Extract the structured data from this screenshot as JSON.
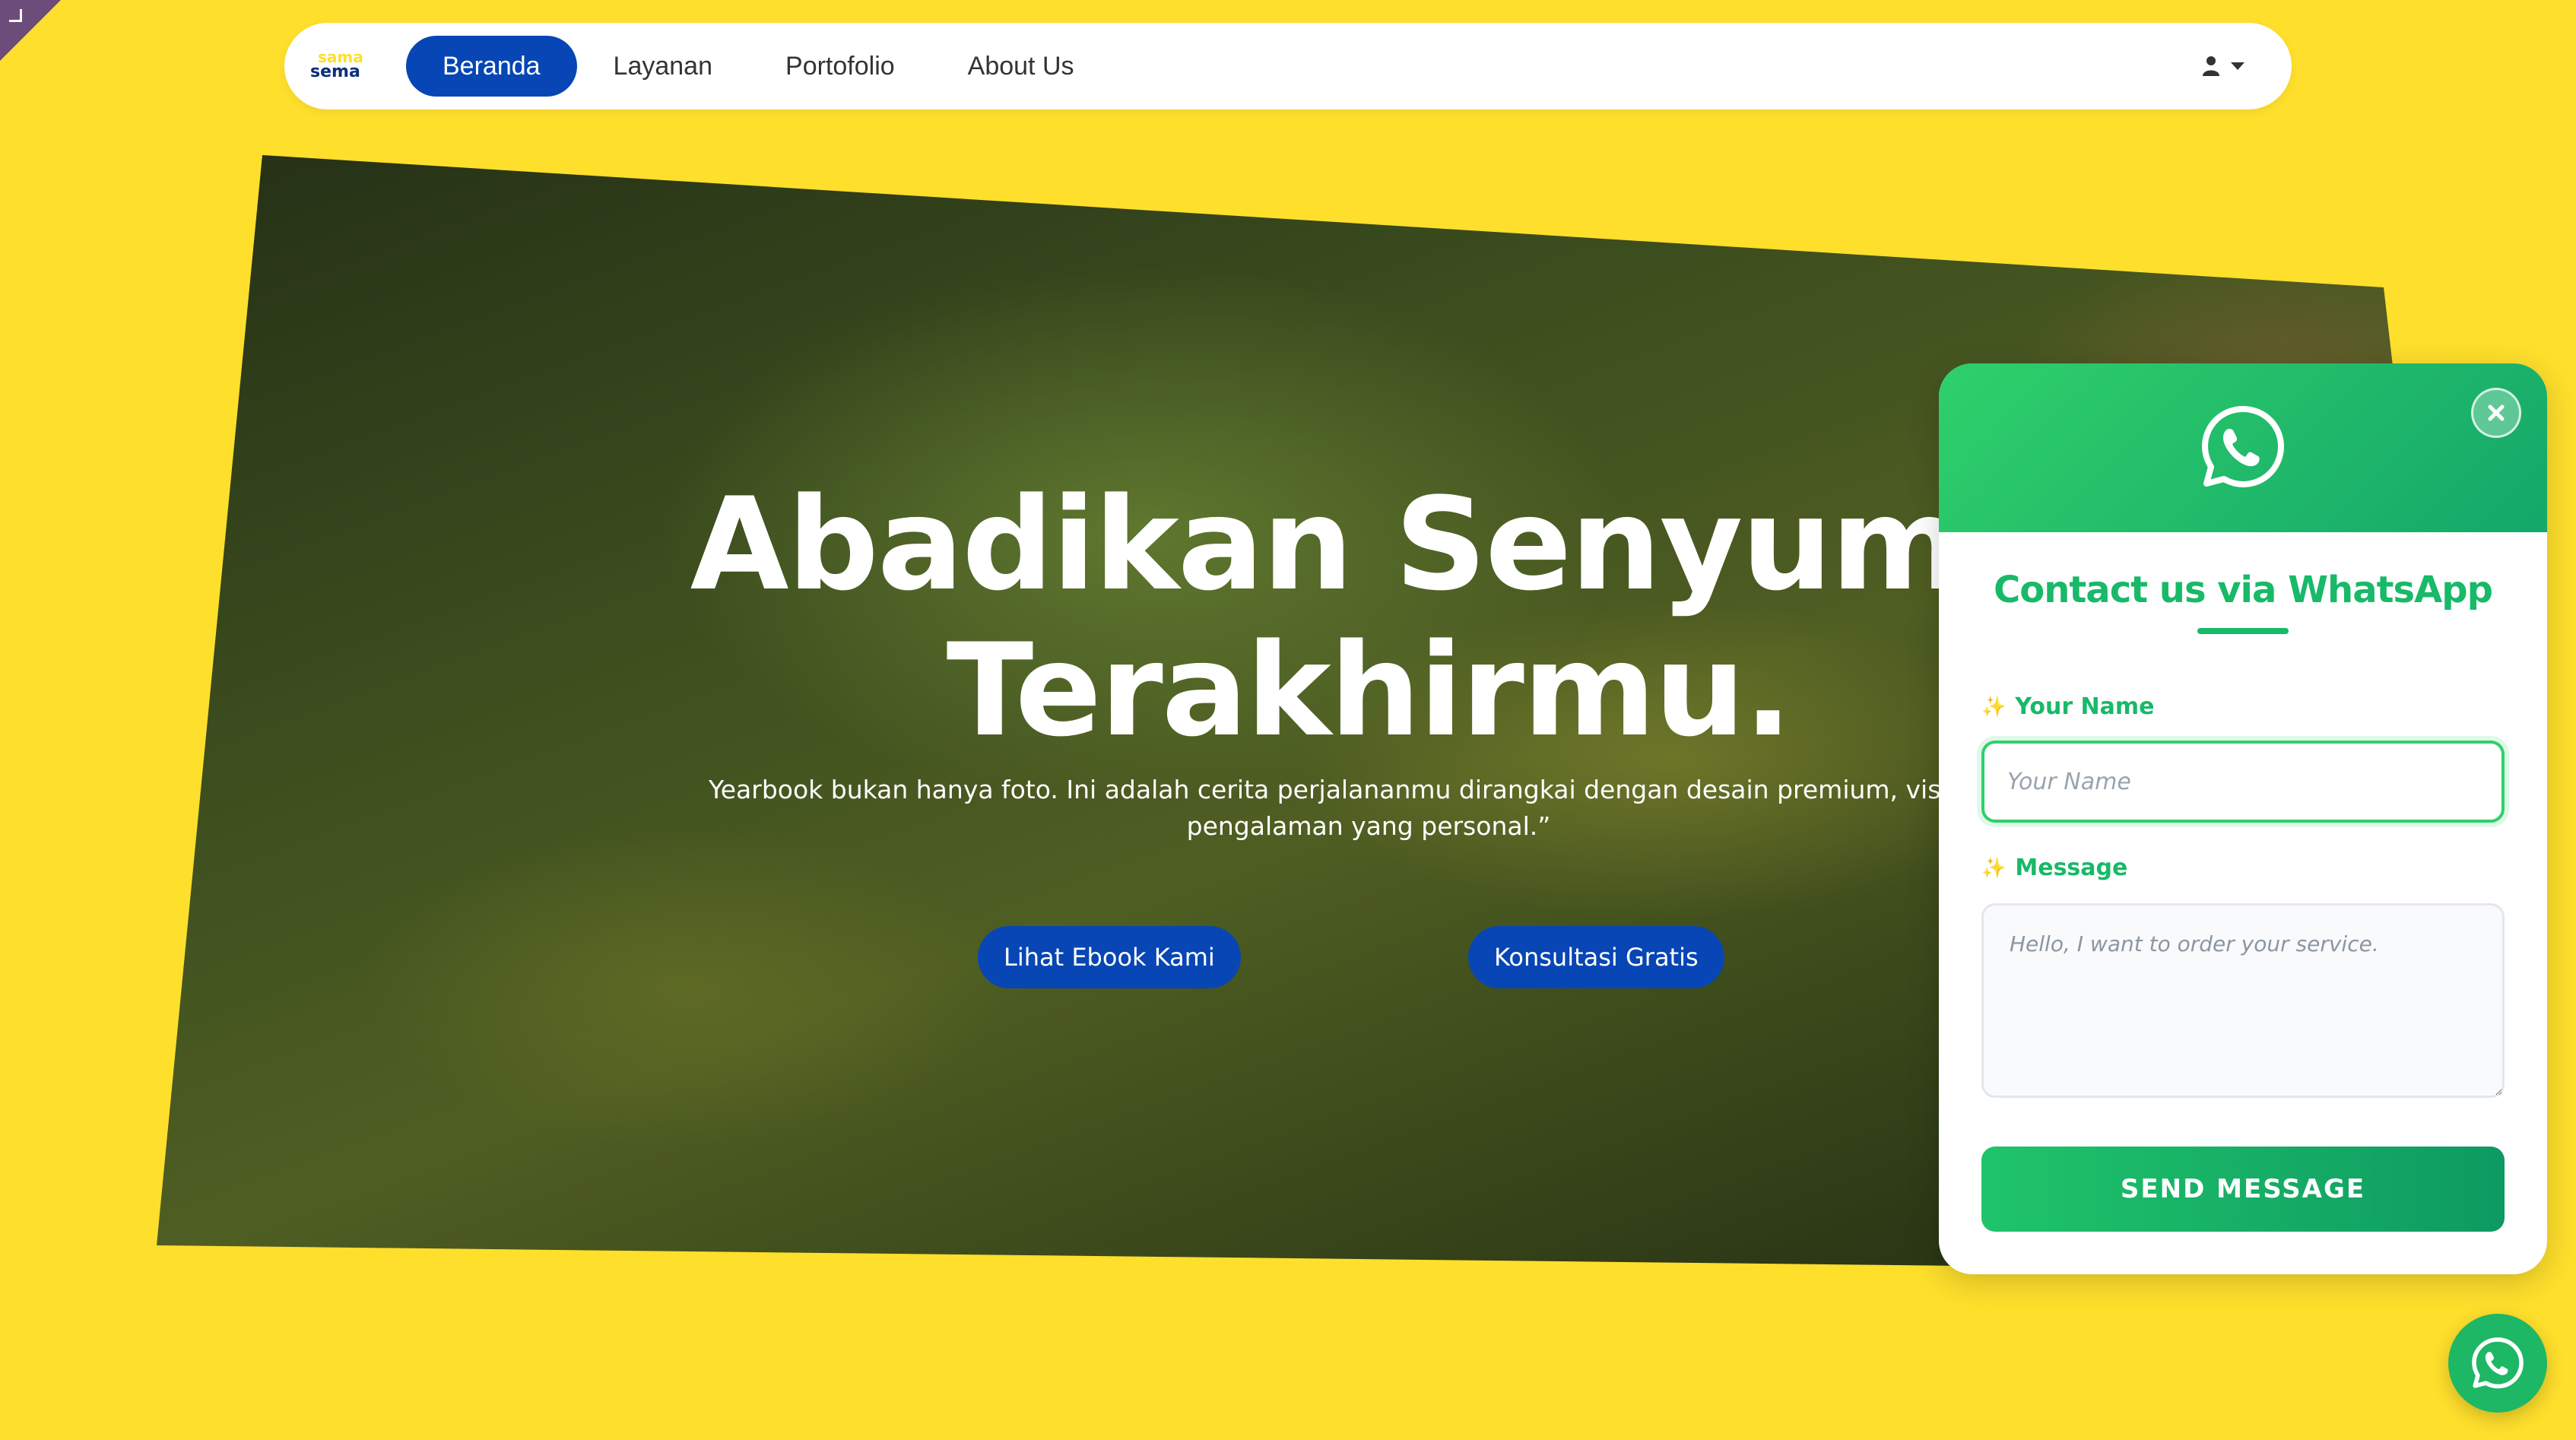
{
  "colors": {
    "page_background": "#FEDF2C",
    "nav_active": "#0746B4",
    "whatsapp_green": "#18B968",
    "hero_button": "#0746B4"
  },
  "navbar": {
    "logo": {
      "line1": "sama",
      "line2": "sema"
    },
    "items": [
      {
        "label": "Beranda",
        "active": true
      },
      {
        "label": "Layanan",
        "active": false
      },
      {
        "label": "Portofolio",
        "active": false
      },
      {
        "label": "About Us",
        "active": false
      }
    ],
    "user_menu": {
      "icon": "user-icon",
      "caret": "caret-down-icon"
    }
  },
  "hero": {
    "title_line1": "Abadikan Senyuma",
    "title_line2": "Terakhirmu.",
    "subtitle_line1": "Yearbook bukan hanya foto. Ini adalah cerita perjalananmu dirangkai dengan desain premium, visual ber",
    "subtitle_line2": "pengalaman yang personal.”",
    "buttons": {
      "primary": "Lihat Ebook Kami",
      "secondary": "Konsultasi Gratis"
    }
  },
  "whatsapp_panel": {
    "header_icon": "whatsapp-icon",
    "close_icon": "close-icon",
    "title": "Contact us via WhatsApp",
    "name_label": "Your Name",
    "name_placeholder": "Your Name",
    "name_value": "",
    "message_label": "Message",
    "message_placeholder": "Hello, I want to order your service.",
    "message_value": "",
    "label_icon": "sparkle-icon",
    "send_label": "SEND MESSAGE"
  },
  "floating_button": {
    "icon": "whatsapp-icon"
  }
}
